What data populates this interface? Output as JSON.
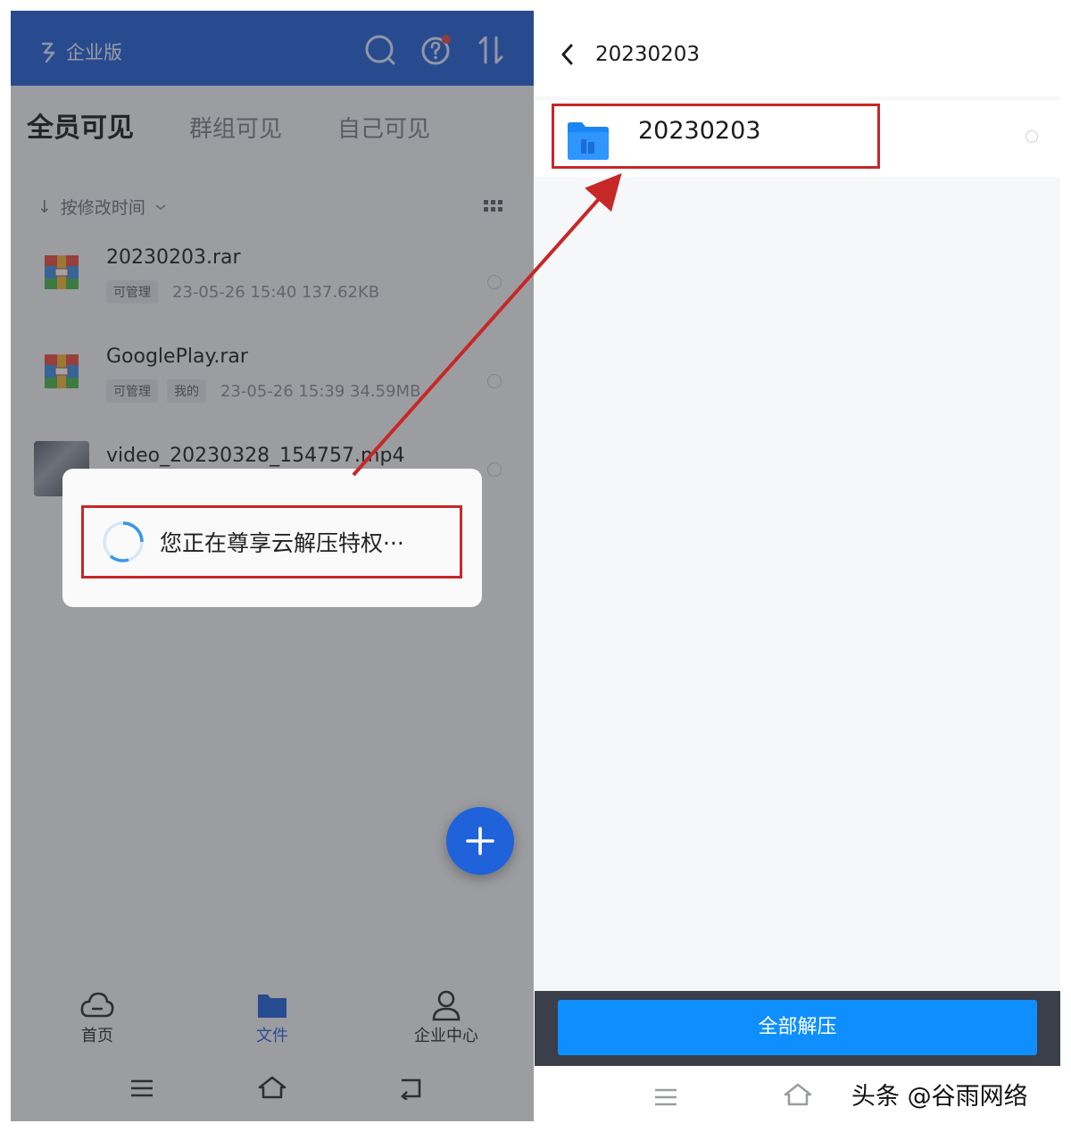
{
  "left": {
    "header": {
      "brand": "企业版"
    },
    "tabs": [
      {
        "label": "全员可见"
      },
      {
        "label": "群组可见"
      },
      {
        "label": "自己可见"
      }
    ],
    "sort_label": "按修改时间",
    "files": [
      {
        "name": "20230203.rar",
        "tags": [
          "可管理"
        ],
        "meta": "23-05-26 15:40  137.62KB"
      },
      {
        "name": "GooglePlay.rar",
        "tags": [
          "可管理",
          "我的"
        ],
        "meta": "23-05-26 15:39  34.59MB"
      },
      {
        "name": "video_20230328_154757.mp4"
      }
    ],
    "dialog": {
      "text": "您正在尊享云解压特权···"
    },
    "tabbar": [
      {
        "label": "首页"
      },
      {
        "label": "文件"
      },
      {
        "label": "企业中心"
      }
    ]
  },
  "right": {
    "title": "20230203",
    "folder": {
      "name": "20230203"
    },
    "extract_button": "全部解压",
    "watermark": "头条 @谷雨网络"
  },
  "colors": {
    "header_blue": "#1f5fd6",
    "accent_blue": "#0f8fff",
    "highlight_red": "#c62828"
  }
}
